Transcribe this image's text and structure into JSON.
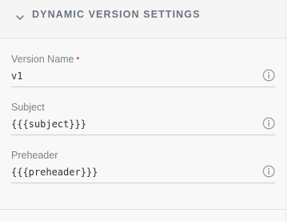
{
  "section": {
    "title": "DYNAMIC VERSION SETTINGS",
    "expanded": true
  },
  "fields": [
    {
      "label": "Version Name",
      "required": true,
      "required_marker": "•",
      "value": "v1"
    },
    {
      "label": "Subject",
      "required": false,
      "value": "{{{subject}}}"
    },
    {
      "label": "Preheader",
      "required": false,
      "value": "{{{preheader}}}"
    }
  ],
  "colors": {
    "label": "#7b8189",
    "value": "#2c333b",
    "required": "#d62b35",
    "header_text": "#6a7480",
    "underline": "#c9cdd2"
  },
  "icons": {
    "header": "chevron-down-icon",
    "field_help": "info-icon"
  }
}
